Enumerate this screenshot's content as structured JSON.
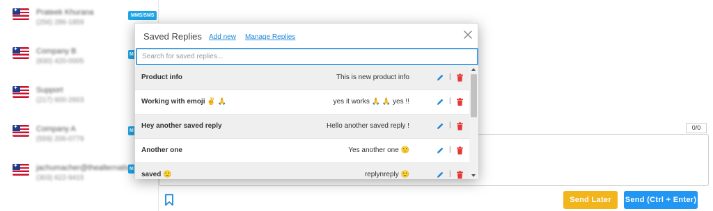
{
  "contacts": [
    {
      "name": "Prateek Khurana",
      "phone": "(256) 286-1859",
      "badge": "MMS/SMS"
    },
    {
      "name": "Company B",
      "phone": "(830) 420-0005",
      "badge": "M"
    },
    {
      "name": "Support",
      "phone": "(217) 600-2603",
      "badge": ""
    },
    {
      "name": "Company A",
      "phone": "(559) 206-0779",
      "badge": "M"
    },
    {
      "name": "jachumacher@thealternative",
      "phone": "(303) 622-9415",
      "badge": "M"
    }
  ],
  "modal": {
    "title": "Saved Replies",
    "add_new": "Add new",
    "manage": "Manage Replies",
    "search_placeholder": "Search for saved replies...",
    "replies": [
      {
        "name": "Product info",
        "text": "This is new product info"
      },
      {
        "name": "Working with emoji ✌️ 🙏",
        "text": "yes it works 🙏 🙏 yes !!"
      },
      {
        "name": "Hey another saved reply",
        "text": "Hello another saved reply !"
      },
      {
        "name": "Another one",
        "text": "Yes another one 🙂"
      },
      {
        "name": "saved 🙂",
        "text": "replynreply 🙂"
      }
    ]
  },
  "compose": {
    "char_count": "0/0",
    "send_later": "Send Later",
    "send": "Send (Ctrl + Enter)"
  },
  "colors": {
    "accent": "#2196f3",
    "send_later": "#f2b51c",
    "badge": "#1ea7e8",
    "edit": "#1e88d6",
    "delete": "#e53935"
  }
}
